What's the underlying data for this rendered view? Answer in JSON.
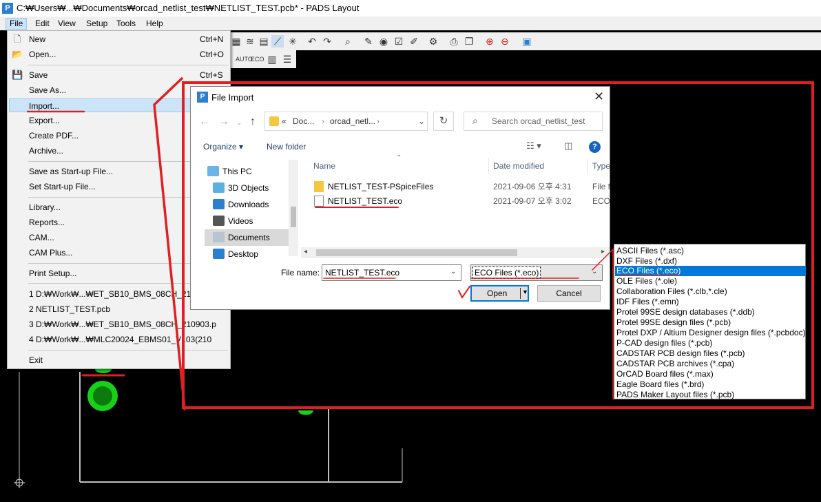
{
  "window": {
    "title": "C:₩Users₩...₩Documents₩orcad_netlist_test₩NETLIST_TEST.pcb* - PADS Layout"
  },
  "menubar": {
    "items": [
      "File",
      "Edit",
      "View",
      "Setup",
      "Tools",
      "Help"
    ],
    "active": "File"
  },
  "file_menu": {
    "items": [
      {
        "label": "New",
        "shortcut": "Ctrl+N",
        "icon": "new-file-icon"
      },
      {
        "label": "Open...",
        "shortcut": "Ctrl+O",
        "icon": "open-folder-icon"
      },
      {
        "label": "Save",
        "shortcut": "Ctrl+S",
        "icon": "save-icon"
      },
      {
        "label": "Save As...",
        "shortcut": ""
      },
      {
        "label": "Import...",
        "shortcut": "",
        "highlighted": true
      },
      {
        "label": "Export...",
        "shortcut": ""
      },
      {
        "label": "Create PDF...",
        "shortcut": ""
      },
      {
        "label": "Archive...",
        "shortcut": ""
      },
      {
        "label": "Save as Start-up File...",
        "shortcut": ""
      },
      {
        "label": "Set Start-up File...",
        "shortcut": ""
      },
      {
        "label": "Library...",
        "shortcut": ""
      },
      {
        "label": "Reports...",
        "shortcut": ""
      },
      {
        "label": "CAM...",
        "shortcut": ""
      },
      {
        "label": "CAM Plus...",
        "shortcut": ""
      },
      {
        "label": "Print Setup...",
        "shortcut": ""
      },
      {
        "label": "1 D:₩Work₩...₩ET_SB10_BMS_08CH_210907a.p",
        "shortcut": ""
      },
      {
        "label": "2 NETLIST_TEST.pcb",
        "shortcut": ""
      },
      {
        "label": "3 D:₩Work₩...₩ET_SB10_BMS_08CH_210903.p",
        "shortcut": ""
      },
      {
        "label": "4 D:₩Work₩...₩MLC20024_EBMS01_V103(210",
        "shortcut": ""
      },
      {
        "label": "Exit",
        "shortcut": ""
      }
    ]
  },
  "dialog": {
    "title": "File Import",
    "breadcrumb": [
      "«",
      "Doc...",
      "orcad_netl..."
    ],
    "search_placeholder": "Search orcad_netlist_test",
    "organize_label": "Organize ▾",
    "new_folder_label": "New folder",
    "nav_items": [
      "This PC",
      "3D Objects",
      "Downloads",
      "Videos",
      "Documents",
      "Desktop"
    ],
    "selected_nav": "Documents",
    "columns": {
      "name": "Name",
      "date": "Date modified",
      "type": "Type"
    },
    "files": [
      {
        "name": "NETLIST_TEST-PSpiceFiles",
        "date": "2021-09-06 오후 4:31",
        "type": "File f",
        "kind": "folder"
      },
      {
        "name": "NETLIST_TEST.eco",
        "date": "2021-09-07 오후 3:02",
        "type": "ECO",
        "kind": "file"
      }
    ],
    "filename_label": "File name:",
    "filename_value": "NETLIST_TEST.eco",
    "filetype_value": "ECO Files (*.eco)",
    "open_label": "Open",
    "cancel_label": "Cancel"
  },
  "filetype_options": [
    "ASCII Files (*.asc)",
    "DXF Files (*.dxf)",
    "ECO Files (*.eco)",
    "OLE Files (*.ole)",
    "Collaboration Files (*.clb,*.cle)",
    "IDF Files (*.emn)",
    "Protel 99SE design databases (*.ddb)",
    "Protel 99SE design files (*.pcb)",
    "Protel DXP / Altium Designer design files (*.pcbdoc)",
    "P-CAD design files (*.pcb)",
    "CADSTAR PCB design files (*.pcb)",
    "CADSTAR PCB archives (*.cpa)",
    "OrCAD Board files (*.max)",
    "Eagle Board files (*.brd)",
    "PADS Maker Layout files (*.pcb)"
  ],
  "selected_filetype_index": 2,
  "toolbar_icons": [
    "layer-icon",
    "route-icon",
    "board-icon",
    "line-icon",
    "grid-icon",
    "undo-icon",
    "redo-icon",
    "zoom-icon",
    "tool-icon",
    "view-icon",
    "check-icon",
    "paint-icon",
    "setup-icon",
    "print-icon",
    "copy-icon",
    "zoom-in-icon",
    "zoom-out-icon",
    "help-icon"
  ],
  "toolbar2_icons": [
    "auto-icon",
    "eco-icon",
    "part-icon",
    "table-icon"
  ],
  "colors": {
    "annotation_red": "#e02020",
    "selection_blue": "#0078d7",
    "pad_green": "#18d018"
  }
}
